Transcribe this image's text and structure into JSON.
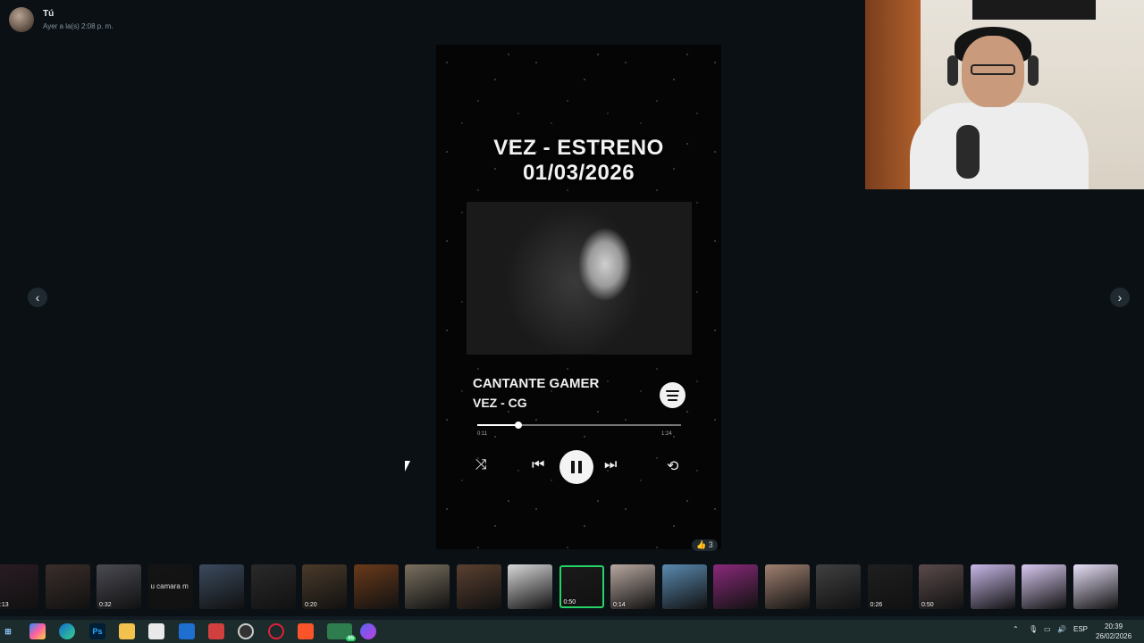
{
  "sender": {
    "name": "Tú",
    "timestamp": "Ayer a la(s) 2:08 p. m."
  },
  "nav": {
    "prev_icon": "‹",
    "next_icon": "›"
  },
  "media": {
    "title_line1": "VEZ - ESTRENO",
    "title_line2": "01/03/2026",
    "artist": "CANTANTE GAMER",
    "track": "VEZ - CG",
    "progress": 0.2,
    "time_elapsed": "0:11",
    "time_total": "1:24"
  },
  "reaction": {
    "emoji": "👍",
    "count": "3"
  },
  "strip": {
    "thumbnails": [
      {
        "duration": "1:13",
        "caption": ""
      },
      {
        "duration": "",
        "caption": ""
      },
      {
        "duration": "0:32",
        "caption": ""
      },
      {
        "duration": "",
        "caption": "u camara m"
      },
      {
        "duration": "",
        "caption": ""
      },
      {
        "duration": "",
        "caption": ""
      },
      {
        "duration": "0:20",
        "caption": ""
      },
      {
        "duration": "",
        "caption": ""
      },
      {
        "duration": "",
        "caption": ""
      },
      {
        "duration": "",
        "caption": ""
      },
      {
        "duration": "",
        "caption": ""
      },
      {
        "duration": "0:50",
        "caption": ""
      },
      {
        "duration": "0:14",
        "caption": ""
      },
      {
        "duration": "",
        "caption": ""
      },
      {
        "duration": "",
        "caption": ""
      },
      {
        "duration": "",
        "caption": ""
      },
      {
        "duration": "",
        "caption": ""
      },
      {
        "duration": "0:26",
        "caption": ""
      },
      {
        "duration": "0:50",
        "caption": ""
      },
      {
        "duration": "",
        "caption": ""
      },
      {
        "duration": "",
        "caption": ""
      },
      {
        "duration": "",
        "caption": ""
      }
    ],
    "selected_index": 11
  },
  "taskbar": {
    "whatsapp_badge": "65",
    "language": "ESP",
    "time": "20:39",
    "date": "26/02/2026"
  },
  "colors": {
    "accent": "#25d366",
    "background": "#0b1014",
    "taskbar": "#1c2b2c"
  }
}
